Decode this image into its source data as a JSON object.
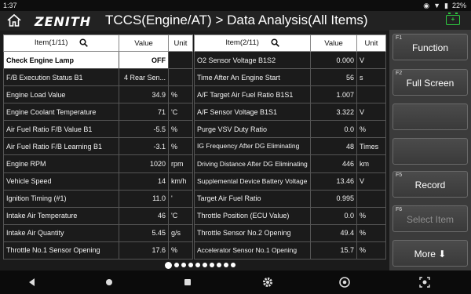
{
  "status": {
    "time": "1:37",
    "battery": "22%"
  },
  "header": {
    "logo": "ZENITH",
    "title": "TCCS(Engine/AT) > Data Analysis(All Items)",
    "battery_icon_text": "+"
  },
  "left_table": {
    "headers": {
      "item": "Item(1/11)",
      "value": "Value",
      "unit": "Unit"
    },
    "rows": [
      {
        "item": "Check Engine Lamp",
        "value": "OFF",
        "unit": ""
      },
      {
        "item": "F/B Execution Status B1",
        "value": "4 Rear Sen...",
        "unit": ""
      },
      {
        "item": "Engine Load Value",
        "value": "34.9",
        "unit": "%"
      },
      {
        "item": "Engine Coolant Temperature",
        "value": "71",
        "unit": "'C"
      },
      {
        "item": "Air Fuel Ratio F/B Value B1",
        "value": "-5.5",
        "unit": "%"
      },
      {
        "item": "Air Fuel Ratio F/B Learning B1",
        "value": "-3.1",
        "unit": "%"
      },
      {
        "item": "Engine RPM",
        "value": "1020",
        "unit": "rpm"
      },
      {
        "item": "Vehicle Speed",
        "value": "14",
        "unit": "km/h"
      },
      {
        "item": "Ignition Timing (#1)",
        "value": "11.0",
        "unit": "'"
      },
      {
        "item": "Intake Air Temperature",
        "value": "46",
        "unit": "'C"
      },
      {
        "item": "Intake Air Quantity",
        "value": "5.45",
        "unit": "g/s"
      },
      {
        "item": "Throttle No.1 Sensor Opening",
        "value": "17.6",
        "unit": "%"
      }
    ]
  },
  "right_table": {
    "headers": {
      "item": "Item(2/11)",
      "value": "Value",
      "unit": "Unit"
    },
    "rows": [
      {
        "item": "O2 Sensor Voltage B1S2",
        "value": "0.000",
        "unit": "V"
      },
      {
        "item": "Time After An Engine Start",
        "value": "56",
        "unit": "s"
      },
      {
        "item": "A/F Target Air Fuel Ratio B1S1",
        "value": "1.007",
        "unit": ""
      },
      {
        "item": "A/F Sensor Voltage B1S1",
        "value": "3.322",
        "unit": "V"
      },
      {
        "item": "Purge VSV Duty Ratio",
        "value": "0.0",
        "unit": "%"
      },
      {
        "item": "IG Frequency After DG Eliminating",
        "value": "48",
        "unit": "Times"
      },
      {
        "item": "Driving Distance After DG Eliminating",
        "value": "446",
        "unit": "km"
      },
      {
        "item": "Supplemental Device Battery Voltage",
        "value": "13.46",
        "unit": "V"
      },
      {
        "item": "Target Air Fuel Ratio",
        "value": "0.995",
        "unit": ""
      },
      {
        "item": "Throttle Position (ECU Value)",
        "value": "0.0",
        "unit": "%"
      },
      {
        "item": "Throttle Sensor No.2 Opening",
        "value": "49.4",
        "unit": "%"
      },
      {
        "item": "Accelerator Sensor No.1 Opening",
        "value": "15.7",
        "unit": "%"
      }
    ]
  },
  "pager": {
    "count": 10,
    "active_index": 0
  },
  "side_buttons": [
    {
      "key": "F1",
      "label": "Function"
    },
    {
      "key": "F2",
      "label": "Full Screen"
    },
    {
      "key": "",
      "label": ""
    },
    {
      "key": "",
      "label": ""
    },
    {
      "key": "F5",
      "label": "Record"
    },
    {
      "key": "F6",
      "label": "Select Item"
    },
    {
      "key": "",
      "label": "More ⬇"
    }
  ],
  "colors": {
    "accent": "#2ecc40",
    "header_bg": "#222222",
    "selected_row": "#ffffff"
  }
}
